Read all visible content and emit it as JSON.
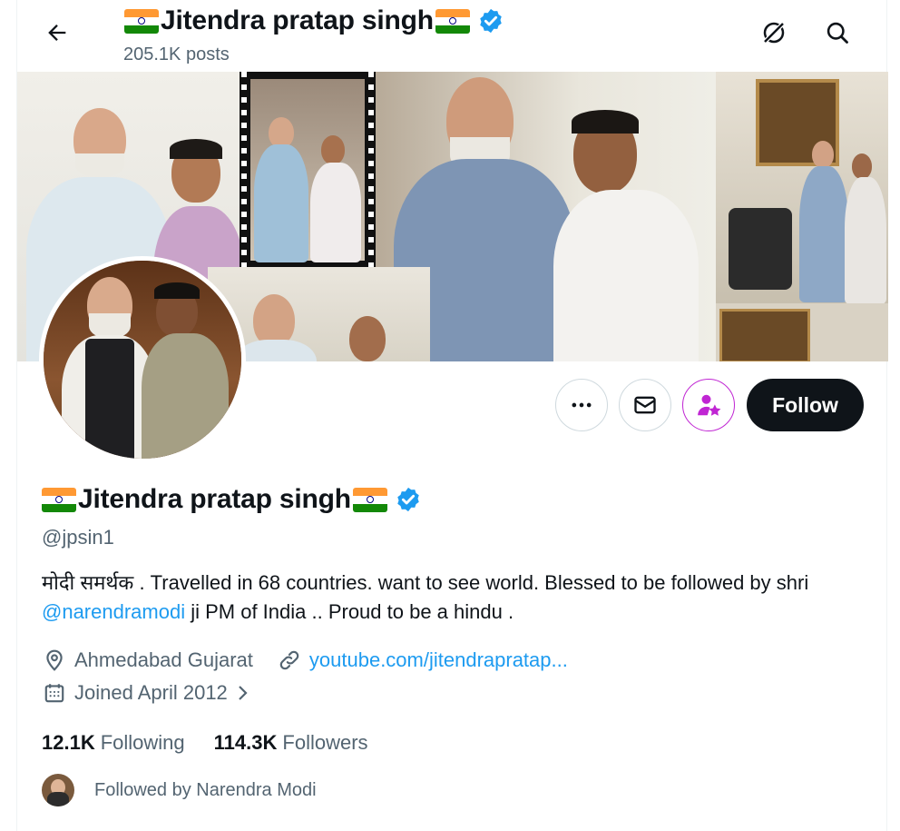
{
  "header": {
    "name": "Jitendra pratap singh",
    "posts": "205.1K posts",
    "back_icon": "arrow-left-icon",
    "grok_icon": "grok-icon",
    "search_icon": "search-icon"
  },
  "profile": {
    "name": "Jitendra pratap singh",
    "handle": "@jpsin1",
    "bio_lead": "मोदी समर्थक . Travelled in 68 countries. want to see world. Blessed to be followed by shri ",
    "bio_mention": "@narendramodi",
    "bio_tail": " ji PM of India .. Proud to be a hindu .",
    "location": "Ahmedabad Gujarat",
    "website": "youtube.com/jitendrapratap...",
    "joined": "Joined April 2012",
    "following_count": "12.1K",
    "following_label": "Following",
    "followers_count": "114.3K",
    "followers_label": "Followers",
    "followed_by": "Followed by Narendra Modi"
  },
  "actions": {
    "more_icon": "more-icon",
    "message_icon": "message-icon",
    "subscribe_icon": "subscribe-icon",
    "follow_label": "Follow"
  },
  "colors": {
    "accent": "#1d9bf0",
    "text": "#0f1419",
    "muted": "#536471",
    "follow_bg": "#0f1419",
    "subscribe": "#c026d3"
  }
}
